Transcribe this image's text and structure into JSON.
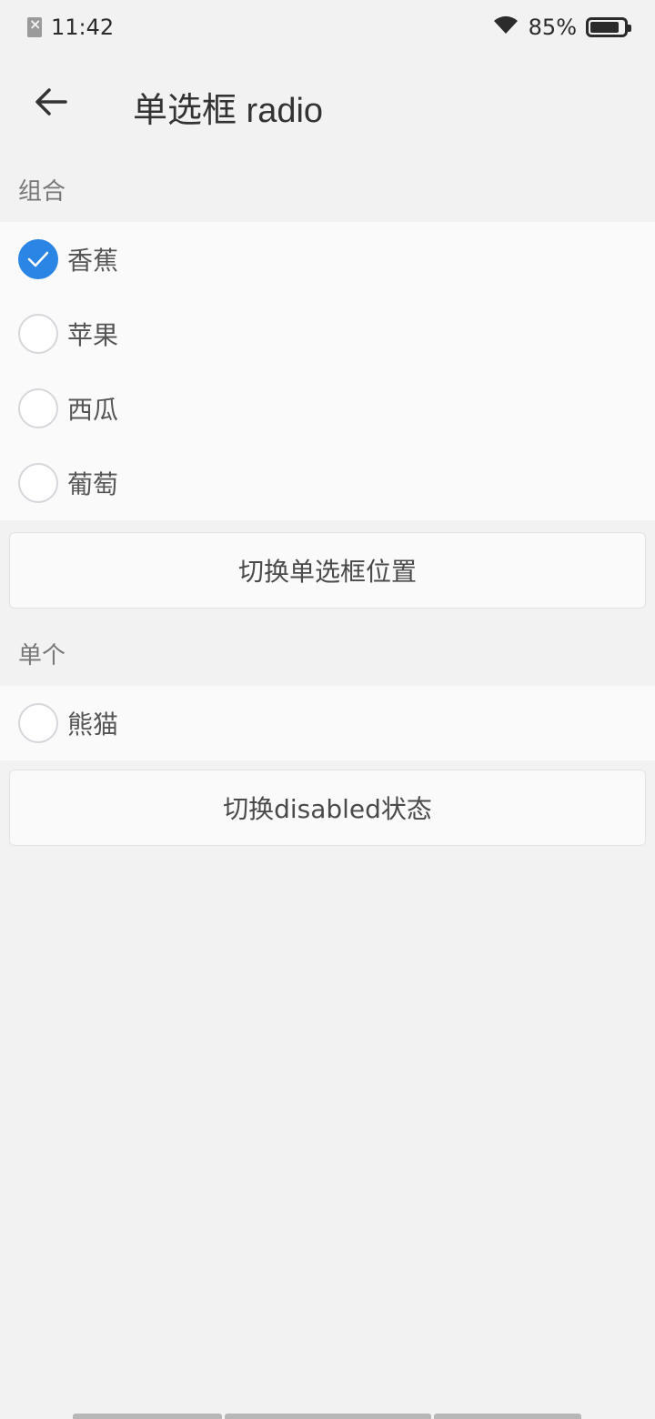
{
  "status": {
    "time": "11:42",
    "battery": "85%",
    "battery_level": 0.85
  },
  "header": {
    "title": "单选框 radio"
  },
  "group_section": {
    "label": "组合",
    "items": [
      {
        "label": "香蕉",
        "checked": true
      },
      {
        "label": "苹果",
        "checked": false
      },
      {
        "label": "西瓜",
        "checked": false
      },
      {
        "label": "葡萄",
        "checked": false
      }
    ],
    "toggle_button": "切换单选框位置"
  },
  "single_section": {
    "label": "单个",
    "item": {
      "label": "熊猫",
      "checked": false
    },
    "toggle_button": "切换disabled状态"
  },
  "colors": {
    "accent": "#2b85e4",
    "background": "#f2f2f2",
    "card": "#fafafa"
  }
}
